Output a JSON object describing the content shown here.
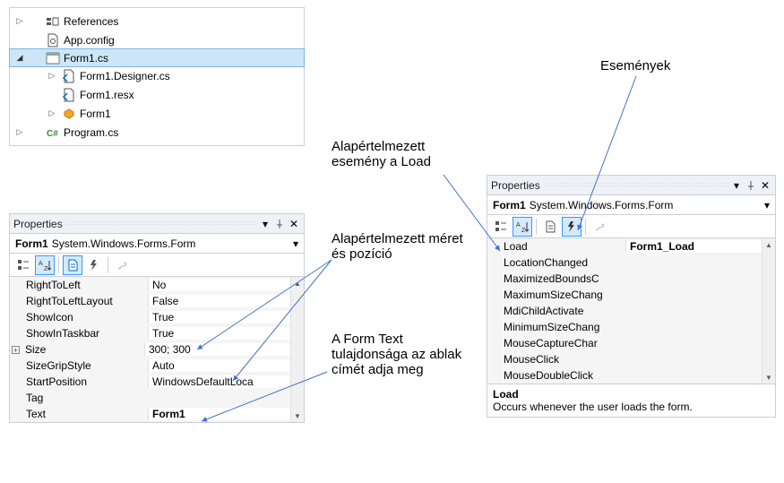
{
  "tree": {
    "items": [
      {
        "indent": 1,
        "caret": "▷",
        "icon": "references",
        "label": "References"
      },
      {
        "indent": 1,
        "caret": "",
        "icon": "config",
        "label": "App.config"
      },
      {
        "indent": 1,
        "caret": "◢",
        "icon": "form",
        "label": "Form1.cs",
        "selected": true
      },
      {
        "indent": 2,
        "caret": "▷",
        "icon": "cs-dep",
        "label": "Form1.Designer.cs"
      },
      {
        "indent": 2,
        "caret": "",
        "icon": "cs-dep",
        "label": "Form1.resx"
      },
      {
        "indent": 2,
        "caret": "▷",
        "icon": "class",
        "label": "Form1"
      },
      {
        "indent": 1,
        "caret": "▷",
        "icon": "cs",
        "label": "Program.cs"
      }
    ]
  },
  "props1": {
    "title": "Properties",
    "object_bold": "Form1",
    "object_rest": "System.Windows.Forms.Form",
    "rows": [
      {
        "name": "RightToLeft",
        "value": "No"
      },
      {
        "name": "RightToLeftLayout",
        "value": "False"
      },
      {
        "name": "ShowIcon",
        "value": "True"
      },
      {
        "name": "ShowInTaskbar",
        "value": "True"
      },
      {
        "name": "Size",
        "value": "300; 300",
        "expander": "+"
      },
      {
        "name": "SizeGripStyle",
        "value": "Auto"
      },
      {
        "name": "StartPosition",
        "value": "WindowsDefaultLoca"
      },
      {
        "name": "Tag",
        "value": ""
      },
      {
        "name": "Text",
        "value": "Form1",
        "bold": true
      }
    ]
  },
  "props2": {
    "title": "Properties",
    "object_bold": "Form1",
    "object_rest": "System.Windows.Forms.Form",
    "rows": [
      {
        "name": "Load",
        "value": "Form1_Load",
        "bold": true
      },
      {
        "name": "LocationChanged",
        "value": ""
      },
      {
        "name": "MaximizedBoundsC",
        "value": ""
      },
      {
        "name": "MaximumSizeChang",
        "value": ""
      },
      {
        "name": "MdiChildActivate",
        "value": ""
      },
      {
        "name": "MinimumSizeChang",
        "value": ""
      },
      {
        "name": "MouseCaptureChar",
        "value": ""
      },
      {
        "name": "MouseClick",
        "value": ""
      },
      {
        "name": "MouseDoubleClick",
        "value": ""
      }
    ],
    "desc_title": "Load",
    "desc_text": "Occurs whenever the user loads the form."
  },
  "annotations": {
    "events": "Események",
    "default_event": "Alapértelmezett esemény a Load",
    "default_size": "Alapértelmezett méret és pozíció",
    "form_text": "A Form Text tulajdonsága az ablak címét adja meg"
  }
}
